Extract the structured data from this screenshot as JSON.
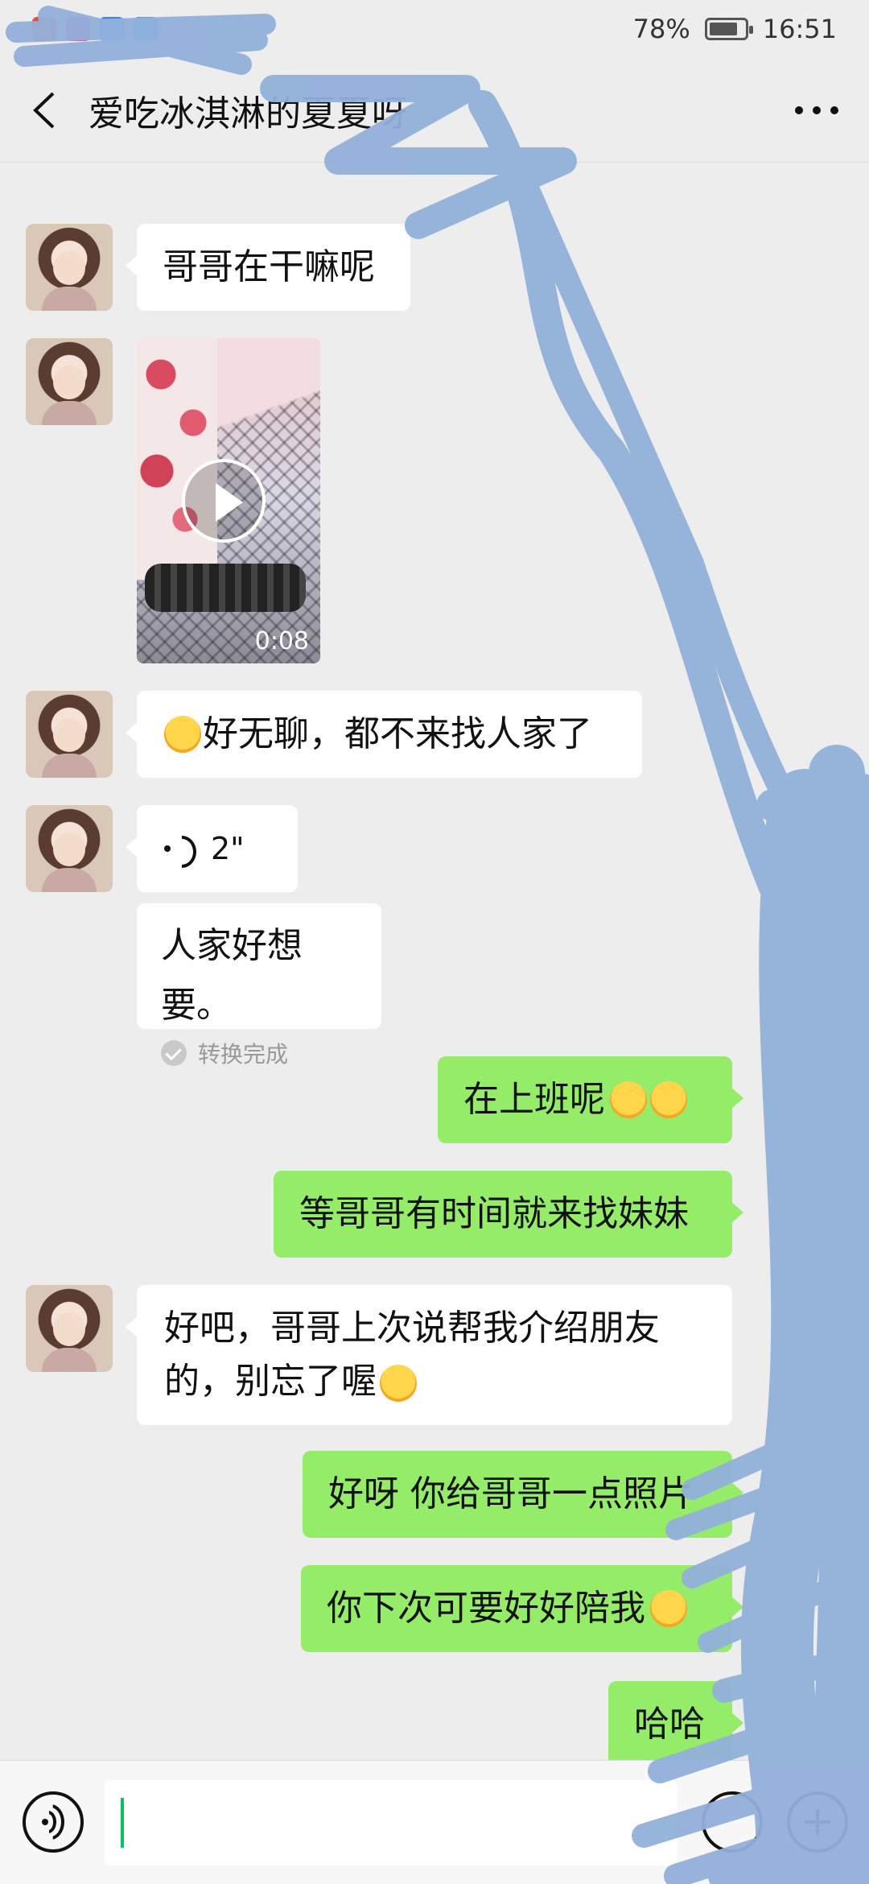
{
  "status_bar": {
    "battery": "78%",
    "time": "16:51",
    "battery_level": 0.78
  },
  "header": {
    "title": "爱吃冰淇淋的夏夏呀"
  },
  "messages": [
    {
      "side": "in",
      "type": "text",
      "text": "哥哥在干嘛呢"
    },
    {
      "side": "in",
      "type": "video",
      "duration": "0:08"
    },
    {
      "side": "in",
      "type": "text",
      "text": "好无聊，都不来找人家了"
    },
    {
      "side": "in",
      "type": "voice",
      "duration": "2\""
    },
    {
      "side": "in",
      "type": "transcription",
      "text": "人家好想要。",
      "status": "转换完成"
    },
    {
      "side": "out",
      "type": "text",
      "text": "在上班呢"
    },
    {
      "side": "out",
      "type": "text",
      "text": "等哥哥有时间就来找妹妹"
    },
    {
      "side": "in",
      "type": "text",
      "line1": "好吧，哥哥上次说帮我介绍朋友",
      "line2": "的，别忘了喔"
    },
    {
      "side": "out",
      "type": "text",
      "text": "好呀 你给哥哥一点照片"
    },
    {
      "side": "out",
      "type": "text",
      "text": "你下次可要好好陪我"
    },
    {
      "side": "out",
      "type": "text",
      "text": "哈哈"
    }
  ],
  "colors": {
    "incoming_bubble": "#ffffff",
    "outgoing_bubble": "#95ec69",
    "background": "#ededed",
    "scribble": "#92b0da"
  }
}
